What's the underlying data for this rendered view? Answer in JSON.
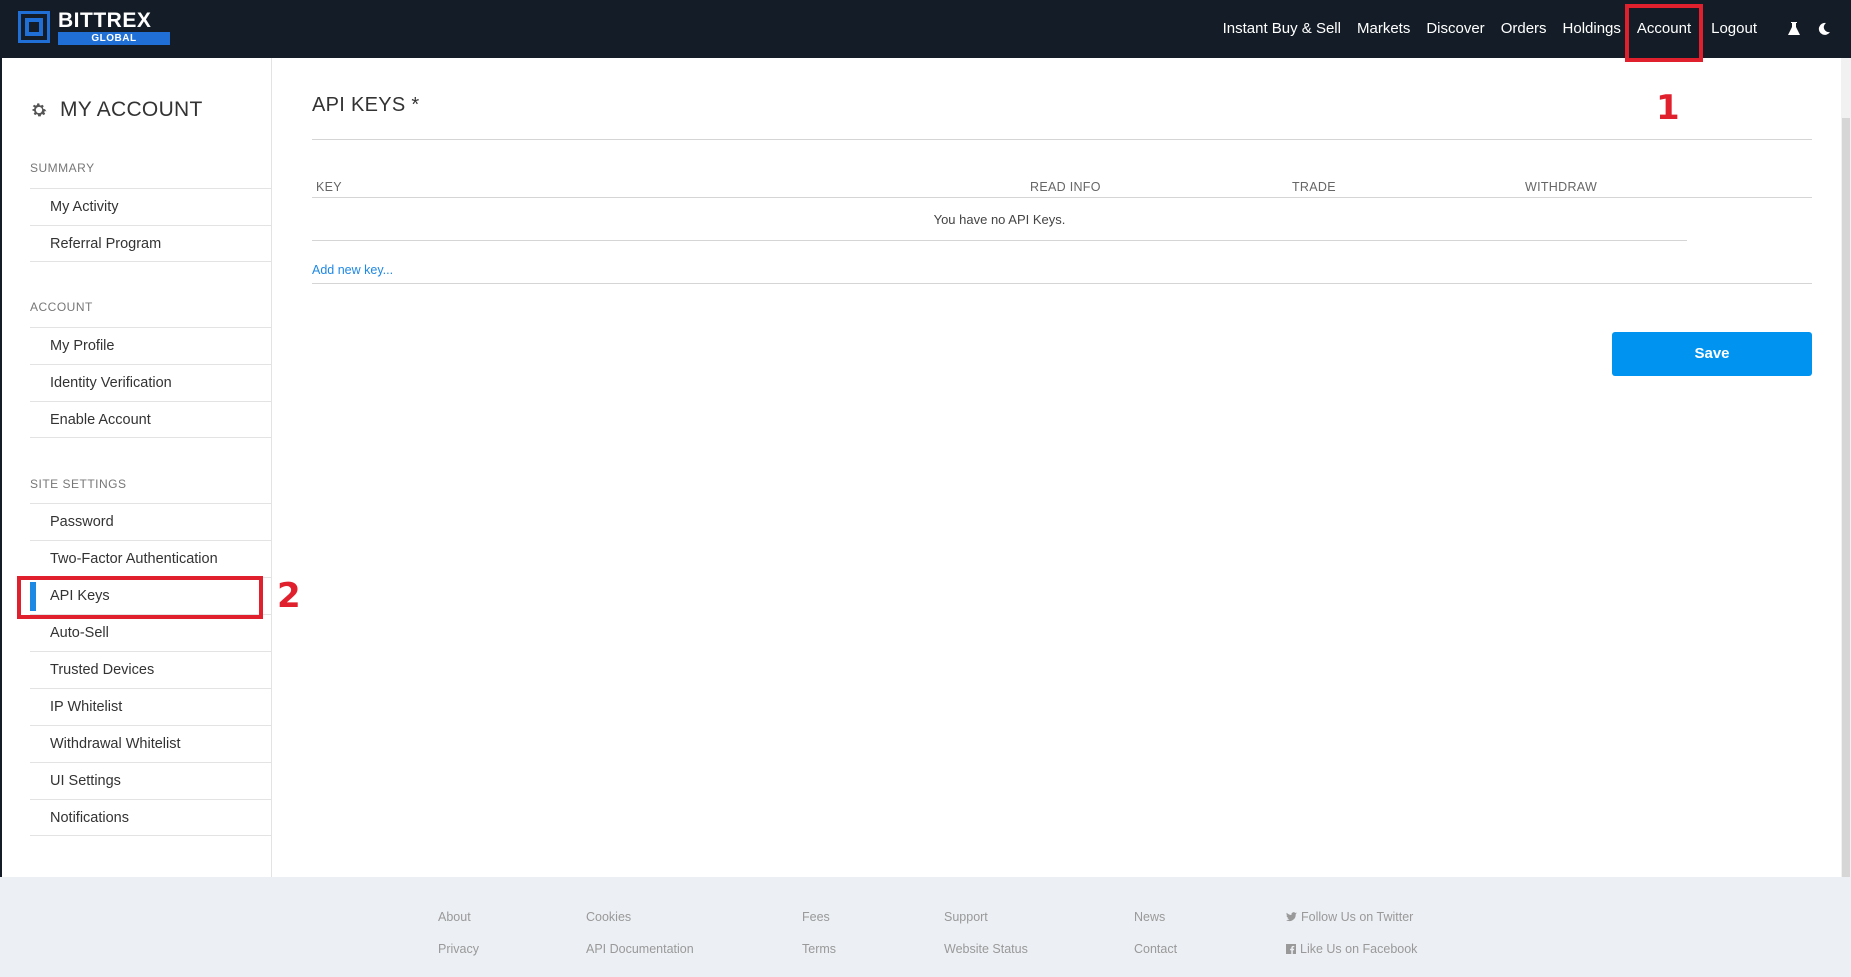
{
  "brand": {
    "name": "BITTREX",
    "sub": "GLOBAL"
  },
  "nav": {
    "items": [
      "Instant Buy & Sell",
      "Markets",
      "Discover",
      "Orders",
      "Holdings",
      "Account",
      "Logout"
    ],
    "icons": [
      "flask-icon",
      "moon-icon"
    ]
  },
  "annotations": {
    "one": "1",
    "two": "2"
  },
  "sidebar": {
    "title": "MY ACCOUNT",
    "sections": [
      {
        "label": "SUMMARY",
        "items": [
          "My Activity",
          "Referral Program"
        ]
      },
      {
        "label": "ACCOUNT",
        "items": [
          "My Profile",
          "Identity Verification",
          "Enable Account"
        ]
      },
      {
        "label": "SITE SETTINGS",
        "items": [
          "Password",
          "Two-Factor Authentication",
          "API Keys",
          "Auto-Sell",
          "Trusted Devices",
          "IP Whitelist",
          "Withdrawal Whitelist",
          "UI Settings",
          "Notifications"
        ]
      }
    ],
    "active": "API Keys"
  },
  "main": {
    "title": "API KEYS *",
    "columns": [
      "KEY",
      "READ INFO",
      "TRADE",
      "WITHDRAW"
    ],
    "empty_message": "You have no API Keys.",
    "add_link": "Add new key...",
    "save_label": "Save"
  },
  "footer": {
    "col1": [
      "About",
      "Privacy"
    ],
    "col2": [
      "Cookies",
      "API Documentation"
    ],
    "col3": [
      "Fees",
      "Terms"
    ],
    "col4": [
      "Support",
      "Website Status"
    ],
    "col5": [
      "News",
      "Contact"
    ],
    "col6": [
      "Follow Us on Twitter",
      "Like Us on Facebook"
    ]
  },
  "colors": {
    "nav_bg": "#141d27",
    "accent": "#0093f0",
    "highlight": "#e0202c",
    "active_bar": "#1e88e5"
  }
}
